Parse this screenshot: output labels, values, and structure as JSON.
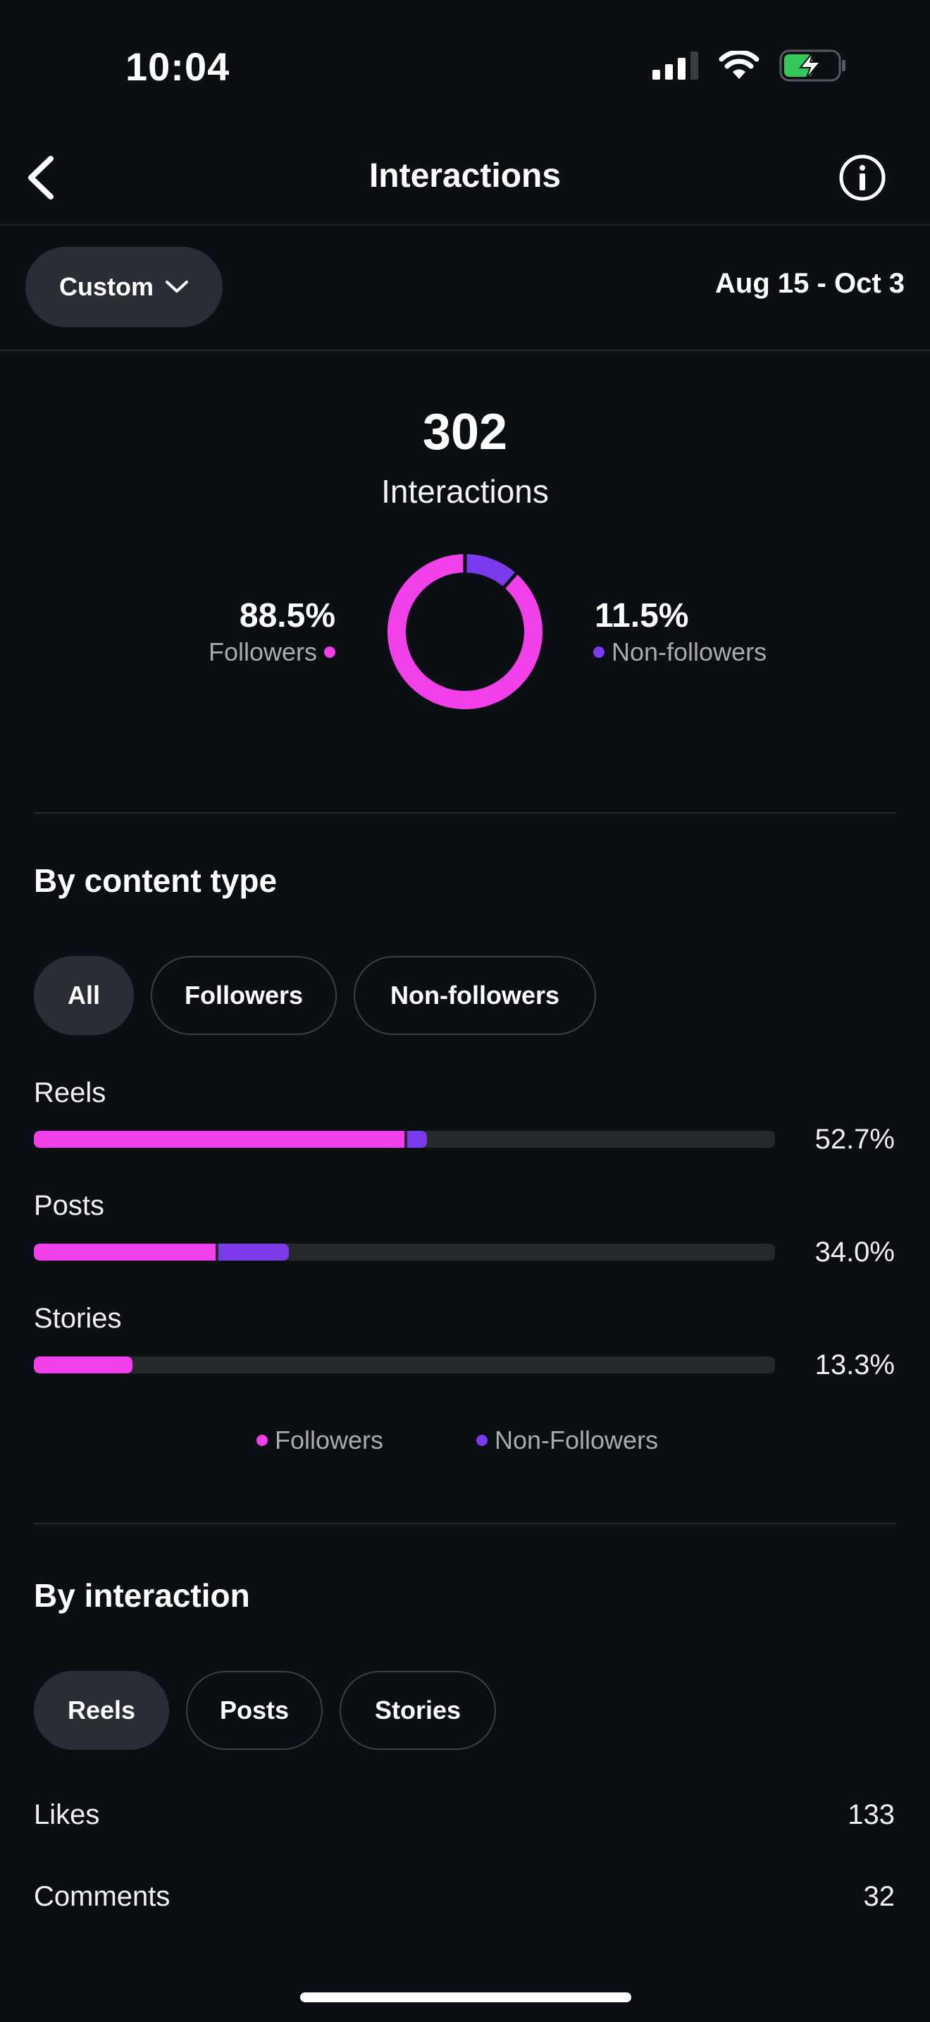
{
  "status": {
    "time": "10:04"
  },
  "header": {
    "title": "Interactions"
  },
  "filter": {
    "range_label": "Custom",
    "date_range": "Aug 15 - Oct 3"
  },
  "summary": {
    "total": "302",
    "total_label": "Interactions",
    "followers_pct": "88.5%",
    "followers_label": "Followers",
    "nonfollowers_pct": "11.5%",
    "nonfollowers_label": "Non-followers",
    "followers_fraction": 0.885,
    "nonfollowers_fraction": 0.115
  },
  "colors": {
    "followers": "#f13fe9",
    "nonfollowers": "#7c3aed",
    "track": "#26292e"
  },
  "content_type": {
    "title": "By content type",
    "tabs": [
      {
        "label": "All",
        "active": true
      },
      {
        "label": "Followers",
        "active": false
      },
      {
        "label": "Non-followers",
        "active": false
      }
    ],
    "rows": [
      {
        "label": "Reels",
        "pct": "52.7%",
        "followers_share": 0.5,
        "nonfollowers_share": 0.027
      },
      {
        "label": "Posts",
        "pct": "34.0%",
        "followers_share": 0.245,
        "nonfollowers_share": 0.095
      },
      {
        "label": "Stories",
        "pct": "13.3%",
        "followers_share": 0.133,
        "nonfollowers_share": 0
      }
    ],
    "legend": {
      "followers": "Followers",
      "nonfollowers": "Non-Followers"
    }
  },
  "by_interaction": {
    "title": "By interaction",
    "tabs": [
      {
        "label": "Reels",
        "active": true
      },
      {
        "label": "Posts",
        "active": false
      },
      {
        "label": "Stories",
        "active": false
      }
    ],
    "items": [
      {
        "label": "Likes",
        "value": "133"
      },
      {
        "label": "Comments",
        "value": "32"
      }
    ]
  }
}
